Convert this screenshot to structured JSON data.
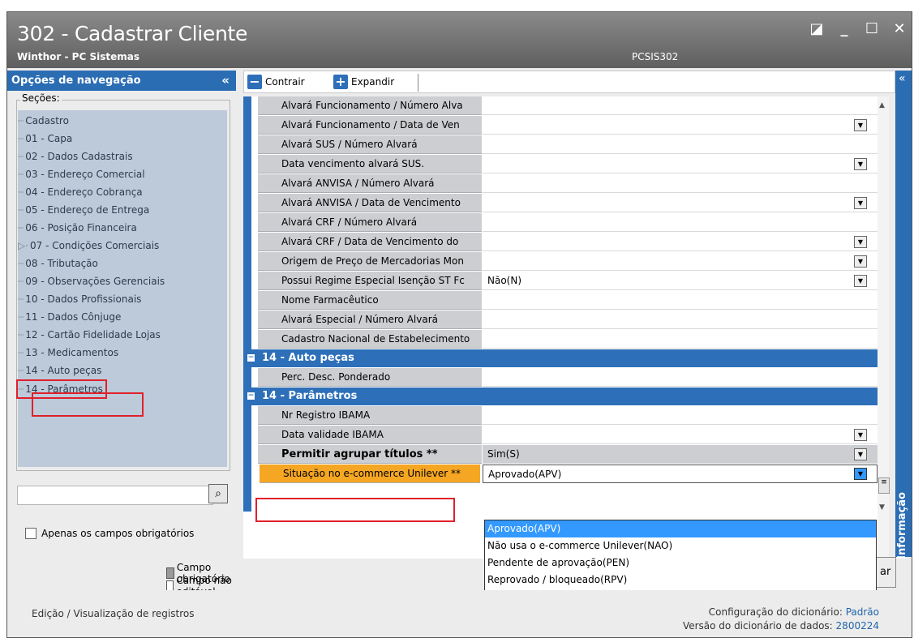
{
  "window": {
    "title": "302 - Cadastrar Cliente",
    "subtitle": "Winthor - PC Sistemas",
    "program_code": "PCSIS302",
    "controls": [
      "restore-icon",
      "minimize-icon",
      "maximize-icon",
      "close-icon"
    ]
  },
  "sidebar": {
    "header": "Opções de navegação",
    "collapse": "«",
    "sections_label": "Seções:",
    "items": [
      "Cadastro",
      "01 - Capa",
      "02 - Dados Cadastrais",
      "03 - Endereço Comercial",
      "04 - Endereço Cobrança",
      "05 - Endereço de Entrega",
      "06 - Posição Financeira",
      "07 - Condições Comerciais",
      "08 - Tributação",
      "09 - Observações Gerenciais",
      "10 - Dados Profissionais",
      "11 - Dados Cônjuge",
      "12 - Cartão Fidelidade Lojas",
      "13 - Medicamentos",
      "14 - Auto peças",
      "14 - Parâmetros"
    ],
    "search_icon": "magnifier-icon",
    "only_required_label": "Apenas os campos obrigatórios",
    "legend_required": "Campo obrigatório",
    "legend_noneditable": "Campo não editável"
  },
  "toolbar": {
    "collapse_label": "Contrair",
    "expand_label": "Expandir"
  },
  "grid": {
    "rows": [
      {
        "label": "Alvará Funcionamento / Número Alva",
        "value": "",
        "dropdown": false
      },
      {
        "label": "Alvará Funcionamento / Data  de Ven",
        "value": "",
        "dropdown": true
      },
      {
        "label": "Alvará SUS / Número Alvará",
        "value": "",
        "dropdown": false
      },
      {
        "label": "Data vencimento alvará SUS.",
        "value": "",
        "dropdown": true
      },
      {
        "label": "Alvará ANVISA / Número Alvará",
        "value": "",
        "dropdown": false
      },
      {
        "label": "Alvará ANVISA / Data  de Vencimento",
        "value": "",
        "dropdown": true
      },
      {
        "label": "Alvará CRF / Número Alvará",
        "value": "",
        "dropdown": false
      },
      {
        "label": "Alvará CRF / Data  de Vencimento do",
        "value": "",
        "dropdown": true
      },
      {
        "label": "Origem de Preço de Mercadorias Mon",
        "value": "",
        "dropdown": true
      },
      {
        "label": "Possui Regime Especial Isenção ST Fc",
        "value": "Não(N)",
        "dropdown": true
      },
      {
        "label": "Nome Farmacêutico",
        "value": "",
        "dropdown": false
      },
      {
        "label": "Alvará Especial / Número Alvará",
        "value": "",
        "dropdown": false
      },
      {
        "label": "Cadastro Nacional de Estabelecimento",
        "value": "",
        "dropdown": false
      }
    ],
    "group_auto": "14 - Auto peças",
    "auto_rows": [
      {
        "label": "Perc. Desc. Ponderado",
        "value": ""
      }
    ],
    "group_params": "14 - Parâmetros",
    "param_rows": [
      {
        "label": "Nr Registro IBAMA",
        "value": ""
      },
      {
        "label": "Data validade IBAMA",
        "value": ""
      },
      {
        "label": "Permitir agrupar títulos **",
        "value": "Sim(S)"
      },
      {
        "label": "Situação no e-commerce Unilever **",
        "value": "Aprovado(APV)"
      }
    ]
  },
  "dropdown": {
    "options": [
      "Aprovado(APV)",
      "Não usa o e-commerce Unilever(NAO)",
      "Pendente de aprovação(PEN)",
      "Reprovado / bloqueado(RPV)"
    ],
    "selected_index": 0
  },
  "info_panel": {
    "label": "Informação",
    "collapse": "«"
  },
  "behind_button_text": "ar",
  "footer": {
    "left": "Edição / Visualização de registros",
    "config_label": "Configuração do dicionário:",
    "config_value": "Padrão",
    "version_label": "Versão do dicionário de dados:",
    "version_value": "2800224"
  },
  "colors": {
    "accent": "#2d6fb8",
    "highlight": "#e0202a",
    "selection": "#3399ff",
    "required_field": "#f5a623"
  }
}
